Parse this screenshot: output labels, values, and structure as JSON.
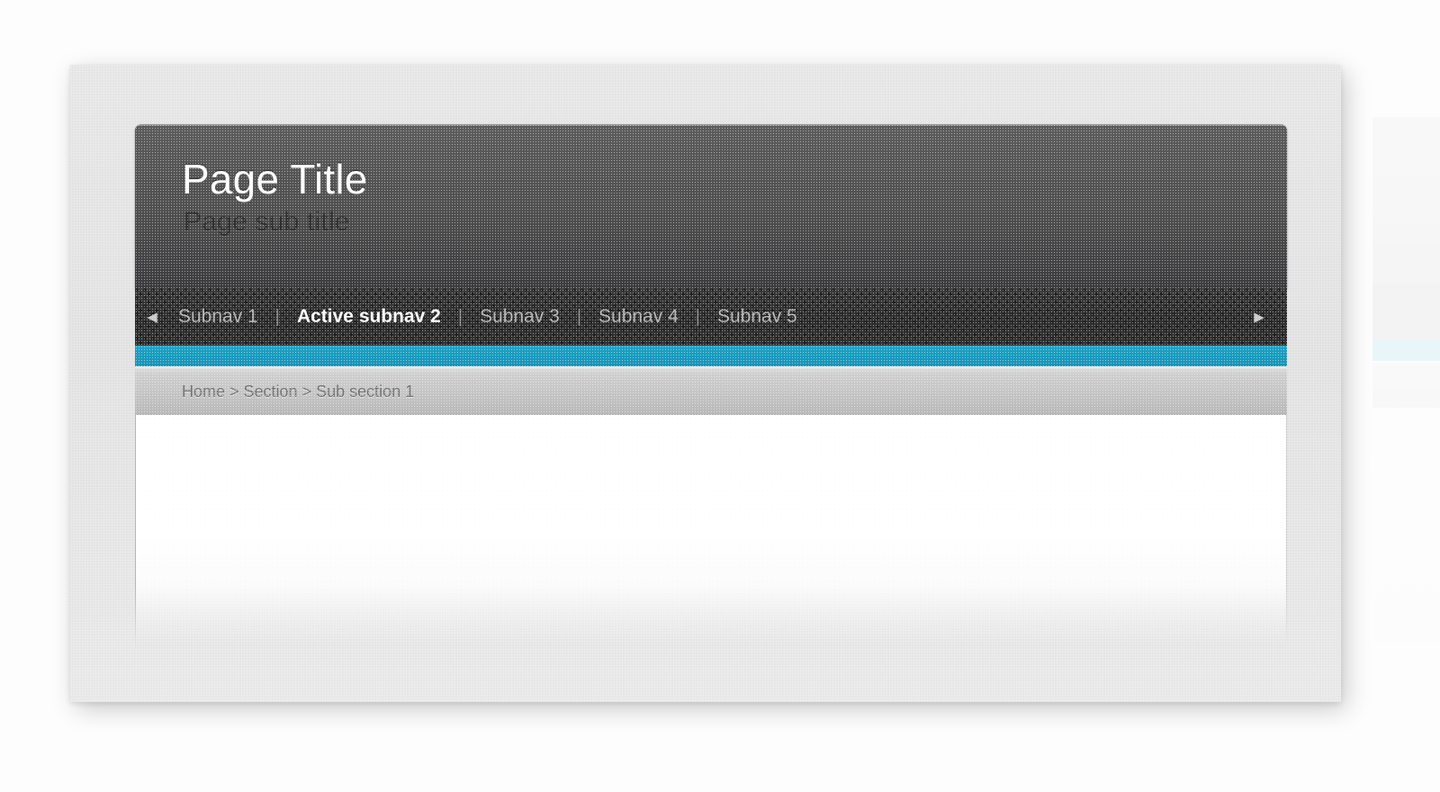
{
  "header": {
    "title": "Page Title",
    "subtitle": "Page sub title"
  },
  "subnav": {
    "prev_arrow": "◀",
    "next_arrow": "▶",
    "separator": "|",
    "items": [
      {
        "label": "Subnav 1",
        "active": false
      },
      {
        "label": "Active subnav 2",
        "active": true
      },
      {
        "label": "Subnav 3",
        "active": false
      },
      {
        "label": "Subnav 4",
        "active": false
      },
      {
        "label": "Subnav 5",
        "active": false
      }
    ]
  },
  "breadcrumb": {
    "text": "Home > Section > Sub section 1",
    "crumbs": [
      "Home",
      "Section",
      "Sub section 1"
    ],
    "separator": ">"
  },
  "content": {
    "body_text": ""
  },
  "colors": {
    "accent": "#1799bd",
    "header_top": "#5b5b5b",
    "header_bottom": "#3a3a3c",
    "subnav_bg": "#303030",
    "breadcrumb_bg": "#c4c4c4",
    "page_frame": "#e4e4e4",
    "title_text": "#fdfdfd",
    "subtitle_text": "#2c2c2e"
  }
}
